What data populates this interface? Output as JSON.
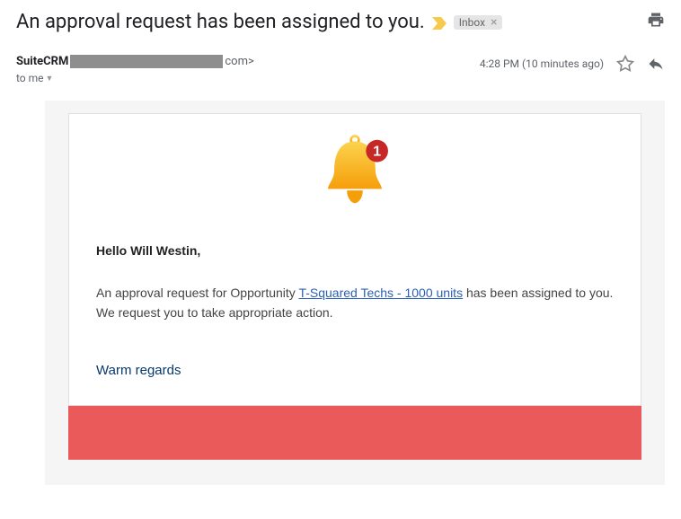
{
  "subject": "An approval request has been assigned to you.",
  "inbox_label": "Inbox",
  "sender": {
    "name": "SuiteCRM",
    "domain_suffix": "com>"
  },
  "to_line": "to me",
  "timestamp": "4:28 PM (10 minutes ago)",
  "card": {
    "badge_count": "1",
    "greeting": "Hello Will Westin,",
    "body_prefix": "An approval request for Opportunity ",
    "link_text": "T-Squared Techs - 1000 units",
    "body_suffix": " has been assigned to you. We request you to take appropriate action.",
    "signoff": "Warm regards"
  }
}
